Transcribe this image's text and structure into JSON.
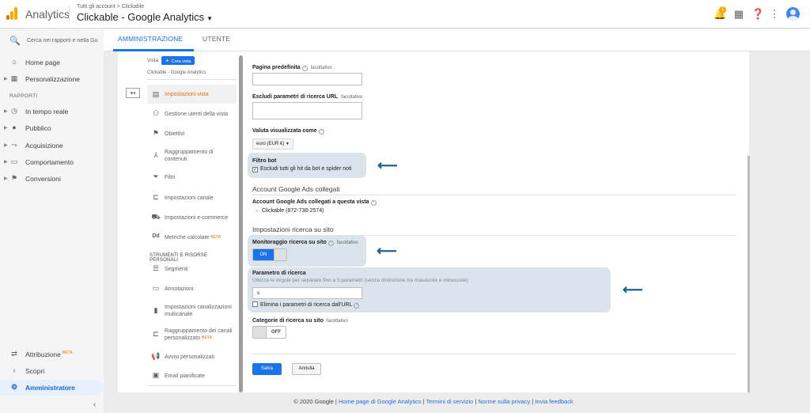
{
  "header": {
    "app_name": "Analytics",
    "breadcrumb": "Tutti gli account > Clickable",
    "property_title": "Clickable - Google Analytics",
    "notification_count": "1"
  },
  "leftnav": {
    "search_placeholder": "Cerca nei rapporti e nella Gu",
    "home": "Home page",
    "custom": "Personalizzazione",
    "reports_section": "RAPPORTI",
    "realtime": "In tempo reale",
    "audience": "Pubblico",
    "acquisition": "Acquisizione",
    "behavior": "Comportamento",
    "conversions": "Conversioni",
    "attribution": "Attribuzione",
    "attribution_badge": "BETA",
    "discover": "Scopri",
    "admin": "Amministratore"
  },
  "tabs": {
    "admin": "AMMINISTRAZIONE",
    "user": "UTENTE"
  },
  "view_column": {
    "view_label": "Vista",
    "create_button": "Crea vista",
    "view_name": "Clickable - Google Analytics",
    "items": [
      {
        "label": "Impostazioni vista",
        "icon": "document-icon"
      },
      {
        "label": "Gestione utenti della vista",
        "icon": "people-icon"
      },
      {
        "label": "Obiettivi",
        "icon": "flag-icon"
      },
      {
        "label": "Raggruppamento di contenuti",
        "icon": "merge-icon"
      },
      {
        "label": "Filtri",
        "icon": "filter-icon"
      },
      {
        "label": "Impostazioni canale",
        "icon": "channel-icon"
      },
      {
        "label": "Impostazioni e-commerce",
        "icon": "cart-icon"
      },
      {
        "label": "Metriche calcolate",
        "icon": "dd-icon",
        "badge": "BETA"
      },
      {
        "label": "Segmenti",
        "icon": "segments-icon"
      },
      {
        "label": "Annotazioni",
        "icon": "annotation-icon"
      },
      {
        "label": "Impostazioni canalizzazioni multicanale",
        "icon": "bar-chart-icon"
      },
      {
        "label": "Raggruppamento dei canali personalizzato",
        "icon": "channel-group-icon",
        "badge": "BETA"
      },
      {
        "label": "Avvisi personalizzati",
        "icon": "megaphone-icon"
      },
      {
        "label": "Email pianificate",
        "icon": "calendar-icon"
      }
    ],
    "tools_section": "STRUMENTI E RISORSE PERSONALI"
  },
  "form": {
    "default_page_label": "Pagina predefinita",
    "optional": "facoltativo",
    "exclude_params_label": "Escludi parametri di ricerca URL",
    "currency_label": "Valuta visualizzata come",
    "currency_value": "euro (EUR €)",
    "bot_filter_label": "Filtro bot",
    "bot_filter_checkbox": "Escludi tutti gli hit da bot e spider noti",
    "ads_section": "Account Google Ads collegati",
    "ads_linked_label": "Account Google Ads collegati a questa vista",
    "ads_account": "Clickable (872-738-2574)",
    "site_search_section": "Impostazioni ricerca su sito",
    "site_search_tracking_label": "Monitoraggio ricerca su sito",
    "toggle_on": "ON",
    "query_param_label": "Parametro di ricerca",
    "query_param_hint": "Utilizza le virgole per separare fino a 5 parametri (senza distinzione tra maiuscole e minuscole)",
    "query_param_value": "s",
    "strip_params_checkbox": "Elimina i parametri di ricerca dall'URL",
    "site_search_categories_label": "Categorie di ricerca su sito",
    "toggle_off": "OFF",
    "save": "Salva",
    "cancel": "Annulla"
  },
  "footer": {
    "copyright": "© 2020 Google |",
    "home_link": "Home page di Google Analytics",
    "terms_link": "Termini di servizio",
    "privacy_link": "Norme sulla privacy",
    "feedback_link": "Invia feedback"
  },
  "colors": {
    "accent": "#1a73e8",
    "highlight": "#dbe3ec",
    "arrow": "#1f6294",
    "active_item": "#e8710a"
  }
}
